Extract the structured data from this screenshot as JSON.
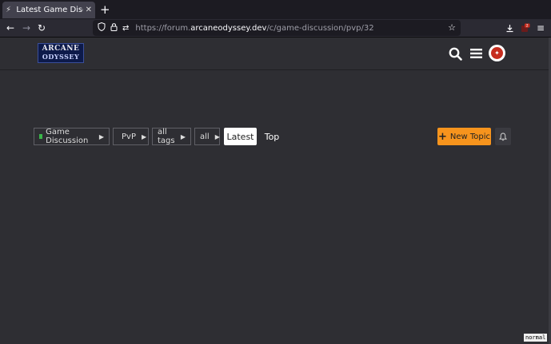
{
  "browser": {
    "tab": {
      "title": "Latest Game Discussion/PvP",
      "favicon": "bolt-icon"
    },
    "url": {
      "scheme": "https://forum.",
      "host": "arcaneodyssey.dev",
      "path": "/c/game-discussion/pvp/32"
    },
    "download_badge": "2"
  },
  "site": {
    "logo_line1": "ARCANE",
    "logo_line2": "ODYSSEY"
  },
  "filters": {
    "category": {
      "label": "Game Discussion",
      "color": "#3ab54a"
    },
    "subcategory": {
      "label": "PvP",
      "color": "#e45735"
    },
    "tags": "all tags",
    "scope": "all"
  },
  "nav": {
    "latest": "Latest",
    "top": "Top"
  },
  "actions": {
    "new_topic": "New Topic"
  },
  "mode_indicator": "normal",
  "colors": {
    "accent": "#f7941d",
    "background": "#2e2e33"
  }
}
